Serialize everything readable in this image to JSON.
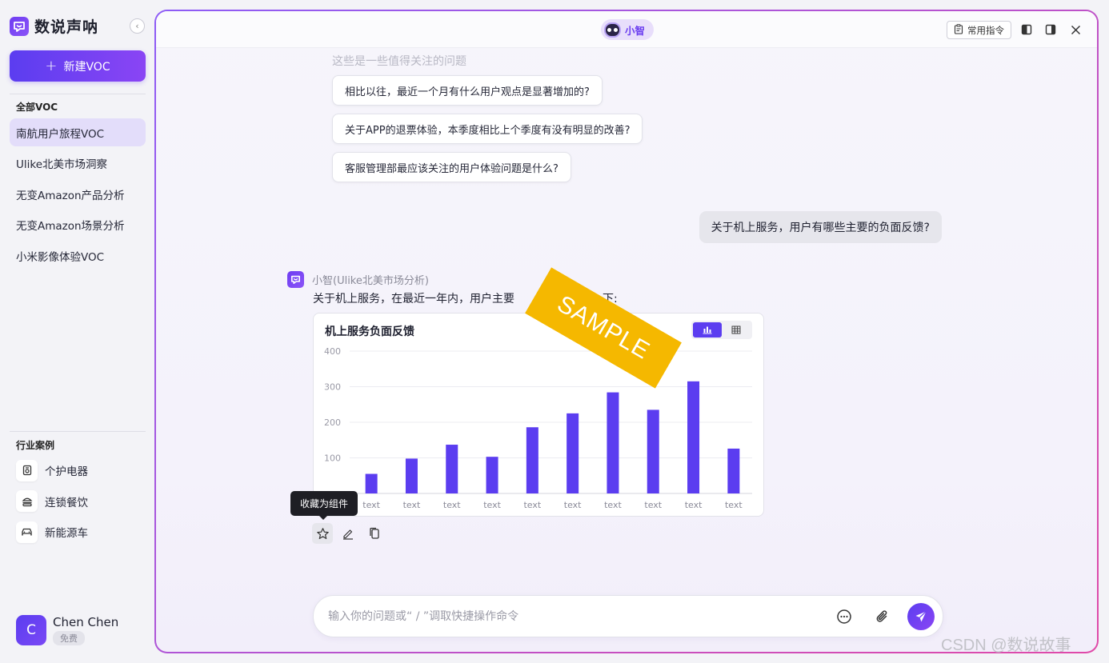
{
  "sidebar": {
    "brand": "数说声呐",
    "new_button": "新建VOC",
    "section_title": "全部VOC",
    "voc_items": [
      {
        "label": "南航用户旅程VOC",
        "active": true
      },
      {
        "label": "Ulike北美市场洞察",
        "active": false
      },
      {
        "label": "无变Amazon产品分析",
        "active": false
      },
      {
        "label": "无变Amazon场景分析",
        "active": false
      },
      {
        "label": "小米影像体验VOC",
        "active": false
      }
    ],
    "case_title": "行业案例",
    "case_items": [
      {
        "label": "个护电器",
        "icon": "appliance-icon"
      },
      {
        "label": "连锁餐饮",
        "icon": "burger-icon"
      },
      {
        "label": "新能源车",
        "icon": "car-icon"
      }
    ],
    "user": {
      "initial": "C",
      "name": "Chen Chen",
      "plan": "免费"
    }
  },
  "topbar": {
    "bot_name": "小智",
    "commands_button": "常用指令"
  },
  "chat": {
    "suggestion_title": "这些是一些值得关注的问题",
    "suggestions": [
      "相比以往，最近一个月有什么用户观点是显著增加的?",
      "关于APP的退票体验，本季度相比上个季度有没有明显的改善?",
      "客服管理部最应该关注的用户体验问题是什么?"
    ],
    "user_message": "关于机上服务，用户有哪些主要的负面反馈?",
    "bot_meta": "小智(Ulike北美市场分析)",
    "bot_text": "关于机上服务，在最近一年内，用户主要",
    "bot_text_tail": "下:",
    "tooltip": "收藏为组件",
    "input_placeholder": "输入你的问题或“ / ”调取快捷操作命令"
  },
  "stamp": "SAMPLE",
  "watermark": "CSDN @数说故事",
  "colors": {
    "accent": "#5b3df0",
    "bar": "#5b3df0",
    "stamp": "#f5b800"
  },
  "chart_data": {
    "type": "bar",
    "title": "机上服务负面反馈",
    "categories": [
      "text",
      "text",
      "text",
      "text",
      "text",
      "text",
      "text",
      "text",
      "text",
      "text"
    ],
    "values": [
      55,
      98,
      137,
      103,
      186,
      225,
      284,
      235,
      315,
      126
    ],
    "yticks": [
      100,
      200,
      300,
      400
    ],
    "ylim": [
      0,
      400
    ],
    "grid": true,
    "legend": false
  }
}
